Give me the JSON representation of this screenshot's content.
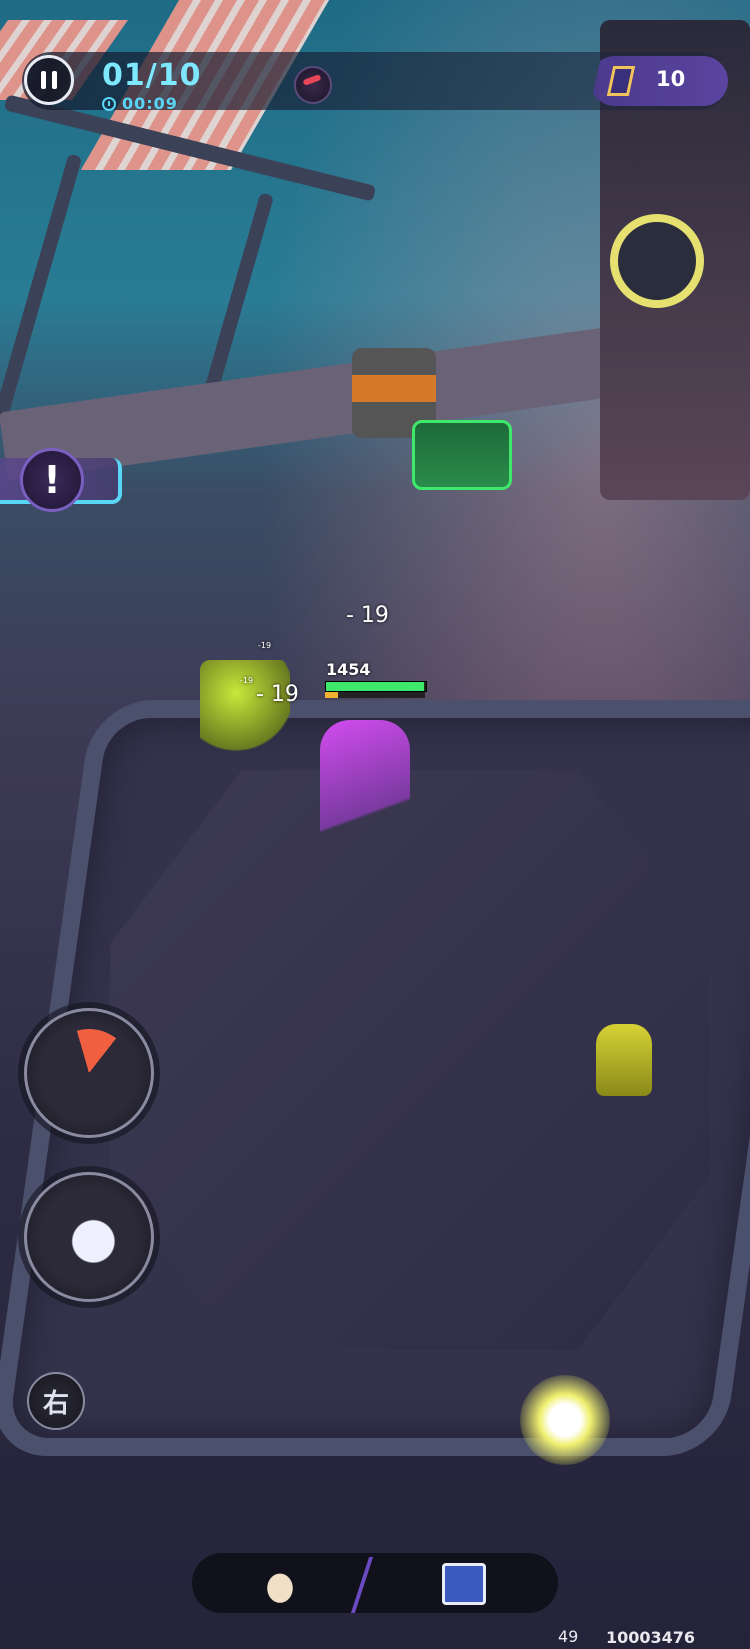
{
  "hud": {
    "wave": "01/10",
    "timer": "00:09",
    "currency_value": "10",
    "alert_symbol": "!"
  },
  "combat": {
    "damage_numbers": [
      "- 19",
      "- 19"
    ],
    "small_damage": [
      "-19",
      "-19"
    ],
    "player_hp": "1454",
    "player_hp_fraction": 0.98,
    "player_energy_fraction": 0.13
  },
  "controls": {
    "swap_label": "右",
    "skills": [
      "slash-skill-icon",
      "dash-skill-icon"
    ],
    "bottom_slots": [
      "boot-icon",
      "card-icon"
    ]
  },
  "footer": {
    "fps": "49",
    "uid": "10003476"
  },
  "colors": {
    "accent_cyan": "#58d6f5",
    "currency_bg": "#5a44a0",
    "hp_green": "#3ee86a",
    "energy_orange": "#f0b030"
  }
}
